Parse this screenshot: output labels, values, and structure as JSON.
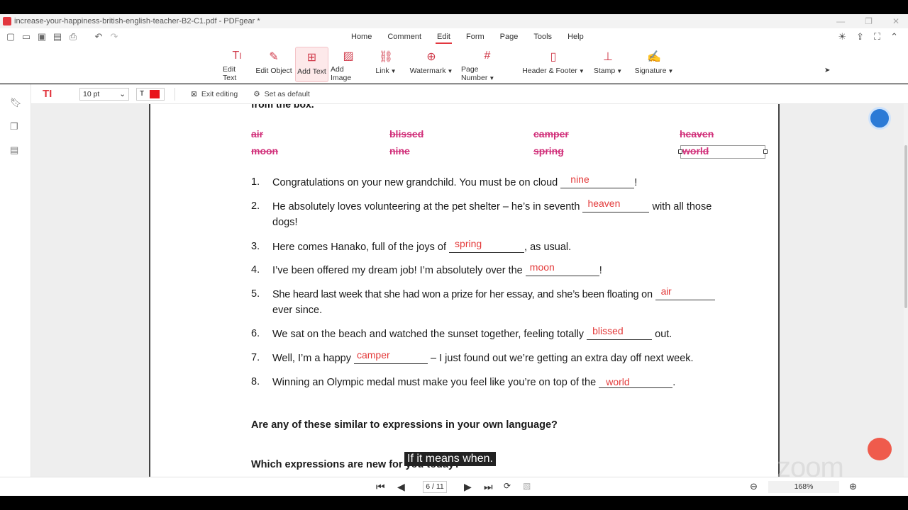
{
  "window": {
    "title": "increase-your-happiness-british-english-teacher-B2-C1.pdf - PDFgear *"
  },
  "menu": {
    "tabs": [
      "Home",
      "Comment",
      "Edit",
      "Form",
      "Page",
      "Tools",
      "Help"
    ],
    "active": "Edit"
  },
  "ribbon": {
    "edit_text": "Edit Text",
    "edit_object": "Edit Object",
    "add_text": "Add Text",
    "add_image": "Add Image",
    "link": "Link",
    "watermark": "Watermark",
    "page_number": "Page Number",
    "header_footer": "Header & Footer",
    "stamp": "Stamp",
    "signature": "Signature"
  },
  "edit_toolbar": {
    "font_size": "10 pt",
    "exit_editing": "Exit editing",
    "set_default": "Set as default",
    "color": "#e8141b"
  },
  "document": {
    "box_heading": "from the box.",
    "words_row1": [
      "air",
      "blissed",
      "camper",
      "heaven"
    ],
    "words_row2": [
      "moon",
      "nine",
      "spring",
      "world"
    ],
    "questions": [
      {
        "num": "1.",
        "before": "Congratulations on your new grandchild. You must be on cloud",
        "answer": "nine",
        "after": "!"
      },
      {
        "num": "2.",
        "before": "He absolutely loves volunteering at the pet shelter – he’s in seventh",
        "answer": "heaven",
        "after": "with all those",
        "line2": "dogs!"
      },
      {
        "num": "3.",
        "before": "Here comes Hanako, full of the joys of",
        "answer": "spring",
        "after": ", as usual."
      },
      {
        "num": "4.",
        "before": "I’ve been offered my dream job! I’m absolutely over the",
        "answer": "moon",
        "after": "!"
      },
      {
        "num": "5.",
        "before": "She heard last week that she had won a prize for her essay, and she’s been floating on",
        "answer": "air",
        "after": "",
        "line2": "ever since."
      },
      {
        "num": "6.",
        "before": "We sat on the beach and watched the sunset together, feeling totally",
        "answer": "blissed",
        "after": "out."
      },
      {
        "num": "7.",
        "before": "Well, I’m a happy",
        "answer": "camper",
        "after": "– I just found out we’re getting an extra day off next week."
      },
      {
        "num": "8.",
        "before": "Winning an Olympic medal must make you feel like you’re on top of the",
        "answer": "world",
        "after": "."
      }
    ],
    "prompt1": "Are any of these similar to expressions in your own language?",
    "prompt2": "Which expressions are new for you today?"
  },
  "caption": "If it means when.",
  "watermark": "zoom",
  "status": {
    "page": "6 / 11",
    "zoom": "168%"
  }
}
